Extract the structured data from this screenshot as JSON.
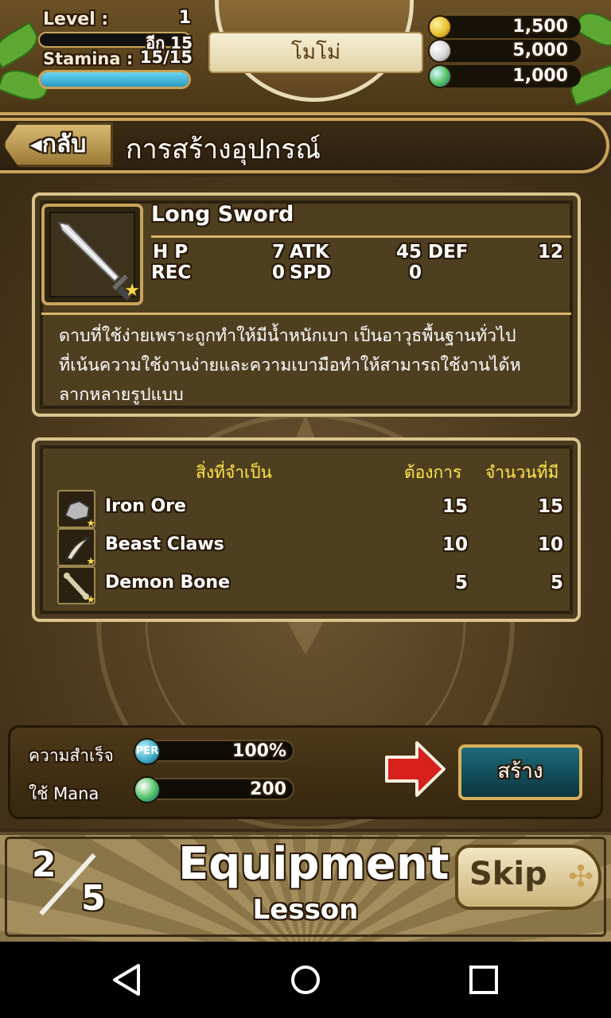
{
  "hud": {
    "level_label": "Level :",
    "level_value": "1",
    "exp_text": "อีก 15",
    "stamina_label": "Stamina :",
    "stamina_value": "15/15",
    "stamina_fraction": 1.0,
    "player_name": "โมโม่",
    "currencies": [
      {
        "icon": "gold-coin-icon",
        "value": "1,500",
        "color": "#e8c030"
      },
      {
        "icon": "silver-coin-icon",
        "value": "5,000",
        "color": "#d8d8d8"
      },
      {
        "icon": "green-orb-icon",
        "value": "1,000",
        "color": "#4fc060"
      }
    ]
  },
  "titlebar": {
    "back_label": "◂กลับ",
    "title": "การสร้างอุปกรณ์"
  },
  "item": {
    "name": "Long Sword",
    "stats": {
      "hp_label": "H P",
      "hp_value": "7",
      "atk_label": "ATK",
      "atk_value": "45",
      "def_label": "DEF",
      "def_value": "12",
      "rec_label": "REC",
      "rec_value": "0",
      "spd_label": "SPD",
      "spd_value": "0"
    },
    "description_lines": [
      "ดาบที่ใช้ง่ายเพราะถูกทำให้มีน้ำหนักเบา เป็นอาวุธพื้นฐานทั่วไป",
      "ที่เน้นความใช้งานง่ายและความเบามือทำให้สามารถใช้งานได้ห",
      "ลากหลายรูปแบบ"
    ]
  },
  "materials": {
    "header_name": "สิ่งที่จำเป็น",
    "header_required": "ต้องการ",
    "header_owned": "จำนวนที่มี",
    "rows": [
      {
        "icon": "iron-ore-icon",
        "name": "Iron Ore",
        "required": "15",
        "owned": "15"
      },
      {
        "icon": "beast-claw-icon",
        "name": "Beast Claws",
        "required": "10",
        "owned": "10"
      },
      {
        "icon": "demon-bone-icon",
        "name": "Demon Bone",
        "required": "5",
        "owned": "5"
      }
    ]
  },
  "craft": {
    "success_label": "ความสำเร็จ",
    "success_icon_text": "PER",
    "success_value": "100%",
    "mana_label": "ใช้ Mana",
    "mana_value": "200",
    "create_label": "สร้าง"
  },
  "lesson": {
    "current": "2",
    "total": "5",
    "title": "Equipment",
    "subtitle": "Lesson",
    "skip_label": "Skip"
  },
  "colors": {
    "accent_gold": "#d8b66a",
    "header_yellow": "#ffe84a",
    "stamina_blue": "#2a9cc4",
    "create_teal": "#1e6a7a"
  }
}
